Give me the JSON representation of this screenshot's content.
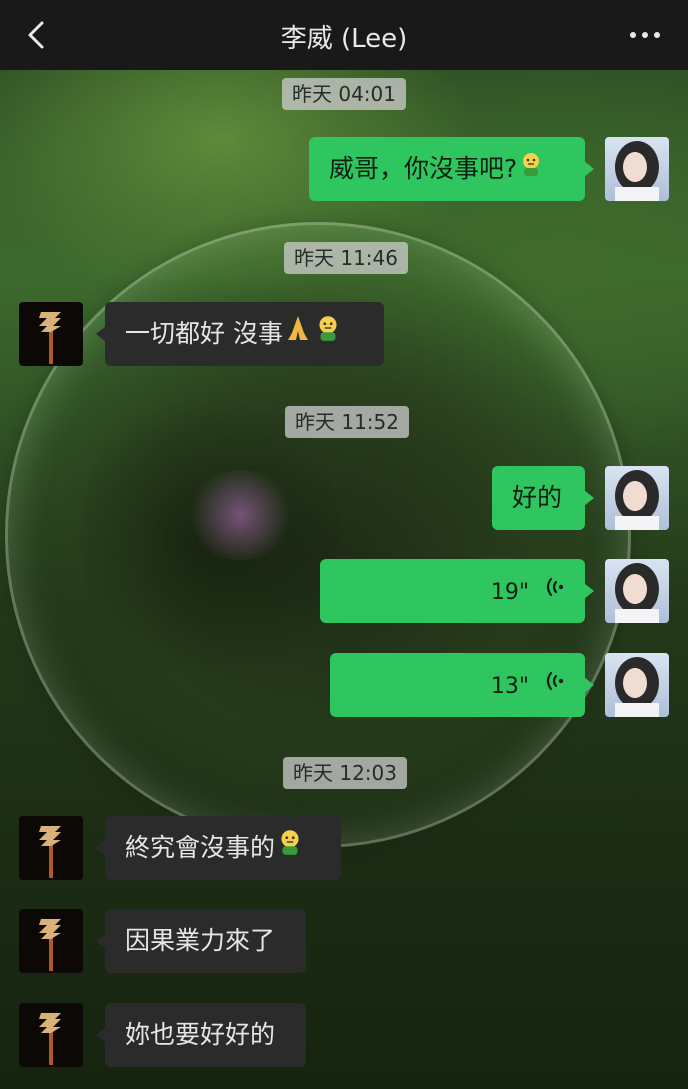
{
  "header": {
    "title": "李威 (Lee)",
    "back_icon": "chevron-left-icon",
    "more_icon": "more-dots-icon",
    "background": "#191919"
  },
  "colors": {
    "outgoing_bubble": "#2fc55f",
    "incoming_bubble": "#2b2b2b",
    "time_pill": "#cdcdcd"
  },
  "messages": {
    "t1": "昨天 04:01",
    "m1": "威哥，你沒事吧?",
    "t2": "昨天 11:46",
    "m2": "一切都好 沒事",
    "t3": "昨天 11:52",
    "m3": "好的",
    "v1": "19\"",
    "v2": "13\"",
    "t4": "昨天 12:03",
    "m4": "終究會沒事的",
    "m5": "因果業力來了",
    "m6": "妳也要好好的"
  }
}
